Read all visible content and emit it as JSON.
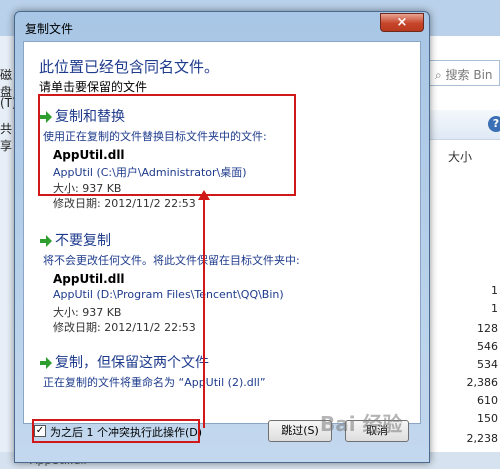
{
  "background": {
    "left_labels": [
      "磁盘",
      "(T)",
      "共享"
    ],
    "search_placeholder": "搜索 Bin",
    "size_column_header": "大小",
    "size_values": [
      "1",
      "1",
      "128",
      "546",
      "534",
      "2,386",
      "610",
      "150",
      "2,238"
    ],
    "status_bar": "AppUtil.dll"
  },
  "dialog": {
    "title": "复制文件",
    "close_label": "×",
    "heading": "此位置已经包含同名文件。",
    "subheading": "请单击要保留的文件",
    "options": [
      {
        "title": "复制和替换",
        "description": "使用正在复制的文件替换目标文件夹中的文件:",
        "file_name": "AppUtil.dll",
        "file_path": "AppUtil (C:\\用户\\Administrator\\桌面)",
        "size": "大小: 937 KB",
        "modified": "修改日期: 2012/11/2 22:53"
      },
      {
        "title": "不要复制",
        "description": "将不会更改任何文件。将此文件保留在目标文件夹中:",
        "file_name": "AppUtil.dll",
        "file_path": "AppUtil (D:\\Program Files\\Tencent\\QQ\\Bin)",
        "size": "大小: 937 KB",
        "modified": "修改日期: 2012/11/2 22:53"
      },
      {
        "title": "复制，但保留这两个文件",
        "description": "正在复制的文件将重命名为 “AppUtil (2).dll”"
      }
    ],
    "checkbox_label": "为之后 1 个冲突执行此操作(D)",
    "checkbox_checked": true,
    "skip_button": "跳过(S)",
    "cancel_button": "取消"
  },
  "watermark": "Bai 经验",
  "colors": {
    "annotation": "#d01818",
    "option_text": "#1e3b8c",
    "arrow_green": "#2e9e2e"
  }
}
